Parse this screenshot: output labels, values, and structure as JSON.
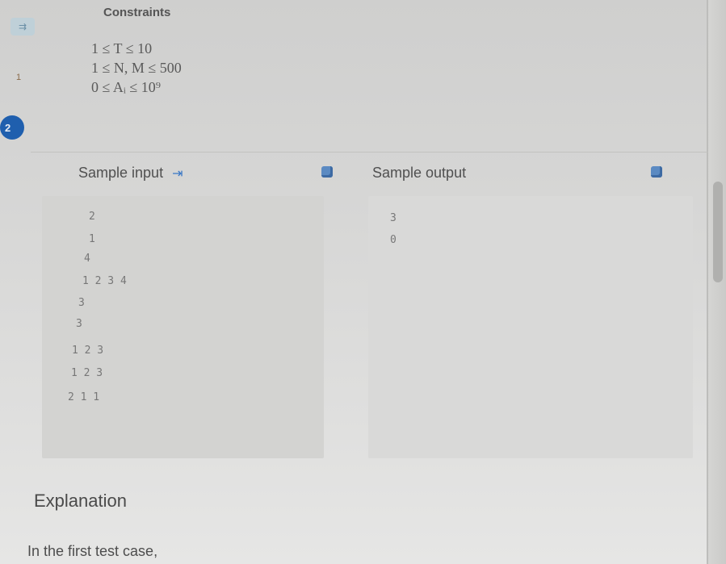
{
  "sidebar": {
    "collapse_icon": "panel-toggle-icon",
    "question_1": "1",
    "question_2": "2",
    "active_color": "#1f5fae"
  },
  "constraints": {
    "title": "Constraints",
    "lines": [
      "1 ≤ T ≤ 10",
      "1 ≤ N, M ≤ 500",
      "0 ≤ Aᵢ ≤ 10⁹"
    ]
  },
  "sample_input": {
    "label": "Sample input",
    "arrow_glyph": "⇥",
    "lines": [
      "2",
      "1",
      "4",
      "1 2 3 4",
      "3",
      "3",
      "1 2 3",
      "1 2 3",
      "2 1 1"
    ]
  },
  "sample_output": {
    "label": "Sample output",
    "lines": [
      "3",
      "0"
    ]
  },
  "explanation": {
    "title": "Explanation",
    "text": "In the first test case,"
  },
  "accent_color": "#3a78c6"
}
